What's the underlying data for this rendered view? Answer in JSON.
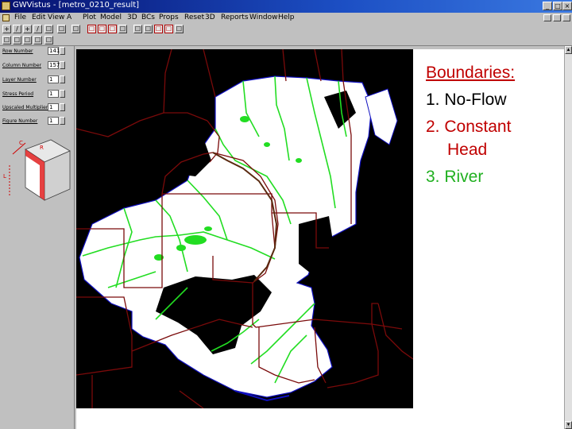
{
  "window": {
    "title": "GWVistus - [metro_0210_result]",
    "buttons": [
      "_",
      "□",
      "×"
    ]
  },
  "menu": {
    "items": [
      "File",
      "Edit",
      "View",
      "A",
      "Plot",
      "Model",
      "3D",
      "BCs",
      "Props",
      "Reset",
      "3D",
      "Reports",
      "Window",
      "Help"
    ]
  },
  "toolbar": {
    "row1": [
      "+",
      "/",
      "+",
      "/",
      "☐",
      "☐",
      "☐",
      "☐",
      "☐",
      "☐",
      "☐",
      "☐",
      "☐",
      "☐",
      "☐",
      "☐",
      "☐",
      "☐",
      "☐",
      "☐"
    ],
    "row2": [
      "☐",
      "☐",
      "☐",
      "☐",
      "☐",
      "☐",
      "☐"
    ]
  },
  "params": {
    "row_number": {
      "label": "Row Number",
      "value": "141"
    },
    "column_number": {
      "label": "Column Number",
      "value": "157"
    },
    "layer_number": {
      "label": "Layer Number",
      "value": "1"
    },
    "stress_period": {
      "label": "Stress Period",
      "value": "1"
    },
    "upscaled_multiplier": {
      "label": "Upscaled Multiplier",
      "value": "1"
    },
    "figure_number": {
      "label": "Figure Number",
      "value": "1"
    }
  },
  "cube": {
    "labels": [
      "C",
      "R",
      "L"
    ]
  },
  "legend": {
    "title": "Boundaries:",
    "item1": "1. No-Flow",
    "item2_line1": "2. Constant",
    "item2_line2": "Head",
    "item3": "3. River"
  },
  "colors": {
    "no_flow": "#000000",
    "active": "#ffffff",
    "river": "#22dd22",
    "boundary_lines": "#7a0a0a",
    "constant_head": "#1010c0",
    "legend_red": "#c00000",
    "legend_green": "#20b020"
  }
}
